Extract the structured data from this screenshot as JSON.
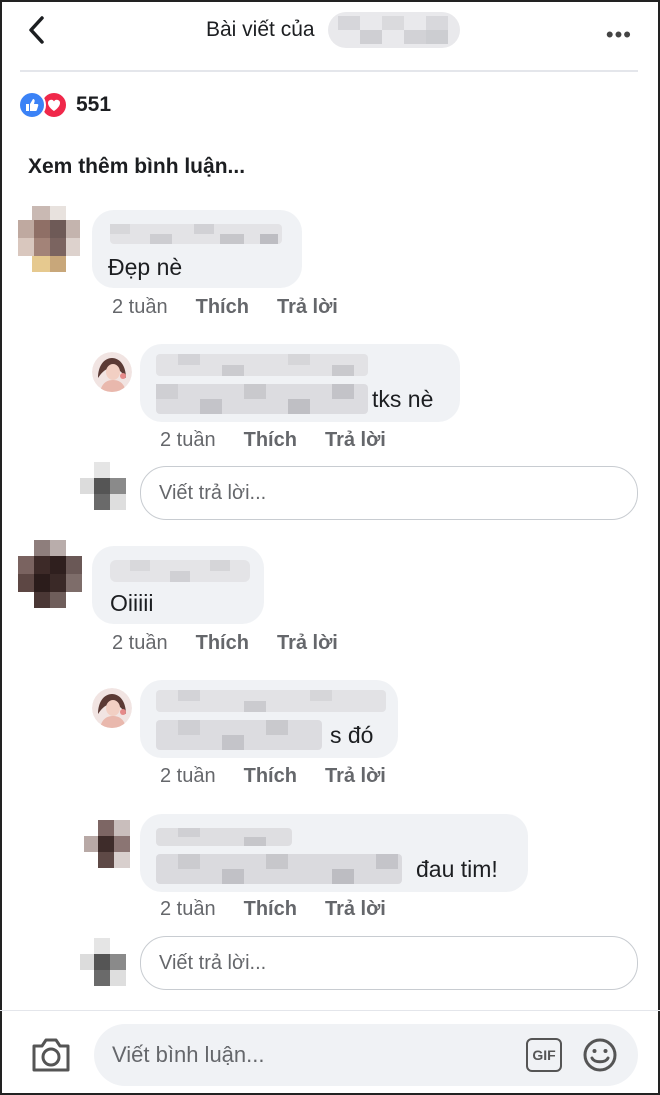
{
  "header": {
    "title": "Bài viết của",
    "more": "•••"
  },
  "reactions": {
    "count": "551"
  },
  "more_comments": "Xem thêm bình luận...",
  "comments": [
    {
      "text": "Đẹp nè",
      "time": "2 tuần",
      "like": "Thích",
      "reply": "Trả lời",
      "replies": [
        {
          "text": "tks nè",
          "time": "2 tuần",
          "like": "Thích",
          "reply": "Trả lời"
        }
      ],
      "reply_placeholder": "Viết trả lời..."
    },
    {
      "text": "Oiiiii",
      "time": "2 tuần",
      "like": "Thích",
      "reply": "Trả lời",
      "replies": [
        {
          "text": "s đó",
          "time": "2 tuần",
          "like": "Thích",
          "reply": "Trả lời"
        },
        {
          "text": "đau tim!",
          "time": "2 tuần",
          "like": "Thích",
          "reply": "Trả lời"
        }
      ],
      "reply_placeholder": "Viết trả lời..."
    }
  ],
  "composer": {
    "placeholder": "Viết bình luận...",
    "gif_label": "GIF"
  },
  "colors": {
    "like_blue": "#3b82f6",
    "love_red": "#f0284a",
    "bubble_bg": "#f0f2f5",
    "meta_gray": "#65676b"
  }
}
